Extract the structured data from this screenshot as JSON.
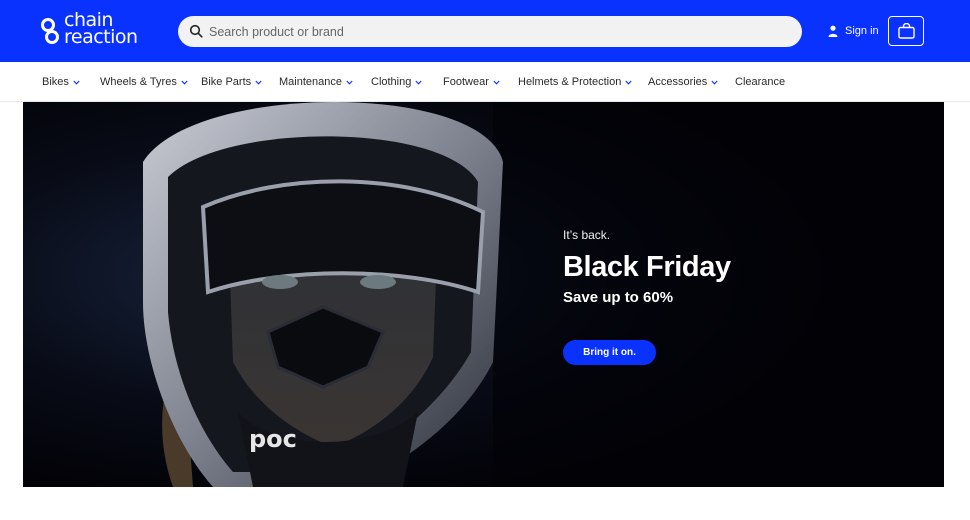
{
  "brand": {
    "line1": "chain",
    "line2": "reaction"
  },
  "search": {
    "placeholder": "Search product or brand",
    "value": ""
  },
  "account": {
    "signin_label": "Sign in"
  },
  "nav": {
    "items": [
      {
        "label": "Bikes",
        "has_menu": true
      },
      {
        "label": "Wheels & Tyres",
        "has_menu": true
      },
      {
        "label": "Bike Parts",
        "has_menu": true
      },
      {
        "label": "Maintenance",
        "has_menu": true
      },
      {
        "label": "Clothing",
        "has_menu": true
      },
      {
        "label": "Footwear",
        "has_menu": true
      },
      {
        "label": "Helmets & Protection",
        "has_menu": true
      },
      {
        "label": "Accessories",
        "has_menu": true
      },
      {
        "label": "Clearance",
        "has_menu": false
      }
    ]
  },
  "hero": {
    "eyebrow": "It’s back.",
    "title": "Black Friday",
    "subtitle": "Save up to 60%",
    "cta_label": "Bring it on.",
    "helmet_brand": "poc"
  },
  "colors": {
    "brand_blue": "#0a32ff",
    "hero_bg": "#020207",
    "text": "#2a2a2a"
  },
  "icons": [
    "chain-logo-icon",
    "search-icon",
    "user-icon",
    "shopping-bag-icon",
    "chevron-down-icon"
  ]
}
